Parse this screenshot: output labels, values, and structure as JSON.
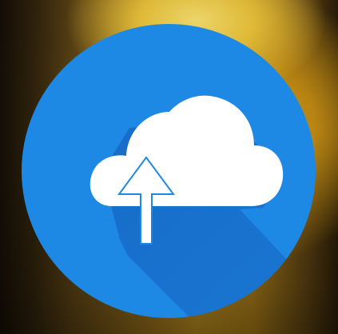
{
  "icon": {
    "name": "cloud-upload-icon",
    "circle_color": "#1e88e5",
    "shadow_color": "#1565c0",
    "cloud_color": "#ffffff",
    "arrow_outline_color": "#1e88e5"
  },
  "background": {
    "palette": [
      "#140e06",
      "#5a4214",
      "#b68a1e",
      "#f6df6e"
    ]
  }
}
